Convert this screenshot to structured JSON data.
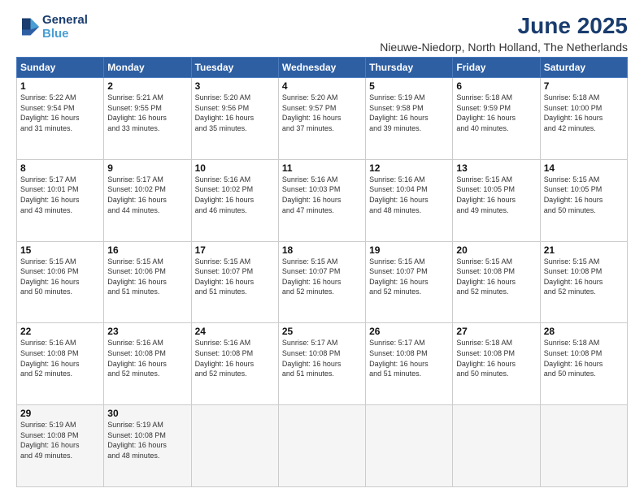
{
  "logo": {
    "line1": "General",
    "line2": "Blue"
  },
  "title": "June 2025",
  "subtitle": "Nieuwe-Niedorp, North Holland, The Netherlands",
  "weekdays": [
    "Sunday",
    "Monday",
    "Tuesday",
    "Wednesday",
    "Thursday",
    "Friday",
    "Saturday"
  ],
  "weeks": [
    [
      {
        "day": "1",
        "detail": "Sunrise: 5:22 AM\nSunset: 9:54 PM\nDaylight: 16 hours\nand 31 minutes."
      },
      {
        "day": "2",
        "detail": "Sunrise: 5:21 AM\nSunset: 9:55 PM\nDaylight: 16 hours\nand 33 minutes."
      },
      {
        "day": "3",
        "detail": "Sunrise: 5:20 AM\nSunset: 9:56 PM\nDaylight: 16 hours\nand 35 minutes."
      },
      {
        "day": "4",
        "detail": "Sunrise: 5:20 AM\nSunset: 9:57 PM\nDaylight: 16 hours\nand 37 minutes."
      },
      {
        "day": "5",
        "detail": "Sunrise: 5:19 AM\nSunset: 9:58 PM\nDaylight: 16 hours\nand 39 minutes."
      },
      {
        "day": "6",
        "detail": "Sunrise: 5:18 AM\nSunset: 9:59 PM\nDaylight: 16 hours\nand 40 minutes."
      },
      {
        "day": "7",
        "detail": "Sunrise: 5:18 AM\nSunset: 10:00 PM\nDaylight: 16 hours\nand 42 minutes."
      }
    ],
    [
      {
        "day": "8",
        "detail": "Sunrise: 5:17 AM\nSunset: 10:01 PM\nDaylight: 16 hours\nand 43 minutes."
      },
      {
        "day": "9",
        "detail": "Sunrise: 5:17 AM\nSunset: 10:02 PM\nDaylight: 16 hours\nand 44 minutes."
      },
      {
        "day": "10",
        "detail": "Sunrise: 5:16 AM\nSunset: 10:02 PM\nDaylight: 16 hours\nand 46 minutes."
      },
      {
        "day": "11",
        "detail": "Sunrise: 5:16 AM\nSunset: 10:03 PM\nDaylight: 16 hours\nand 47 minutes."
      },
      {
        "day": "12",
        "detail": "Sunrise: 5:16 AM\nSunset: 10:04 PM\nDaylight: 16 hours\nand 48 minutes."
      },
      {
        "day": "13",
        "detail": "Sunrise: 5:15 AM\nSunset: 10:05 PM\nDaylight: 16 hours\nand 49 minutes."
      },
      {
        "day": "14",
        "detail": "Sunrise: 5:15 AM\nSunset: 10:05 PM\nDaylight: 16 hours\nand 50 minutes."
      }
    ],
    [
      {
        "day": "15",
        "detail": "Sunrise: 5:15 AM\nSunset: 10:06 PM\nDaylight: 16 hours\nand 50 minutes."
      },
      {
        "day": "16",
        "detail": "Sunrise: 5:15 AM\nSunset: 10:06 PM\nDaylight: 16 hours\nand 51 minutes."
      },
      {
        "day": "17",
        "detail": "Sunrise: 5:15 AM\nSunset: 10:07 PM\nDaylight: 16 hours\nand 51 minutes."
      },
      {
        "day": "18",
        "detail": "Sunrise: 5:15 AM\nSunset: 10:07 PM\nDaylight: 16 hours\nand 52 minutes."
      },
      {
        "day": "19",
        "detail": "Sunrise: 5:15 AM\nSunset: 10:07 PM\nDaylight: 16 hours\nand 52 minutes."
      },
      {
        "day": "20",
        "detail": "Sunrise: 5:15 AM\nSunset: 10:08 PM\nDaylight: 16 hours\nand 52 minutes."
      },
      {
        "day": "21",
        "detail": "Sunrise: 5:15 AM\nSunset: 10:08 PM\nDaylight: 16 hours\nand 52 minutes."
      }
    ],
    [
      {
        "day": "22",
        "detail": "Sunrise: 5:16 AM\nSunset: 10:08 PM\nDaylight: 16 hours\nand 52 minutes."
      },
      {
        "day": "23",
        "detail": "Sunrise: 5:16 AM\nSunset: 10:08 PM\nDaylight: 16 hours\nand 52 minutes."
      },
      {
        "day": "24",
        "detail": "Sunrise: 5:16 AM\nSunset: 10:08 PM\nDaylight: 16 hours\nand 52 minutes."
      },
      {
        "day": "25",
        "detail": "Sunrise: 5:17 AM\nSunset: 10:08 PM\nDaylight: 16 hours\nand 51 minutes."
      },
      {
        "day": "26",
        "detail": "Sunrise: 5:17 AM\nSunset: 10:08 PM\nDaylight: 16 hours\nand 51 minutes."
      },
      {
        "day": "27",
        "detail": "Sunrise: 5:18 AM\nSunset: 10:08 PM\nDaylight: 16 hours\nand 50 minutes."
      },
      {
        "day": "28",
        "detail": "Sunrise: 5:18 AM\nSunset: 10:08 PM\nDaylight: 16 hours\nand 50 minutes."
      }
    ],
    [
      {
        "day": "29",
        "detail": "Sunrise: 5:19 AM\nSunset: 10:08 PM\nDaylight: 16 hours\nand 49 minutes."
      },
      {
        "day": "30",
        "detail": "Sunrise: 5:19 AM\nSunset: 10:08 PM\nDaylight: 16 hours\nand 48 minutes."
      },
      {
        "day": "",
        "detail": ""
      },
      {
        "day": "",
        "detail": ""
      },
      {
        "day": "",
        "detail": ""
      },
      {
        "day": "",
        "detail": ""
      },
      {
        "day": "",
        "detail": ""
      }
    ]
  ]
}
